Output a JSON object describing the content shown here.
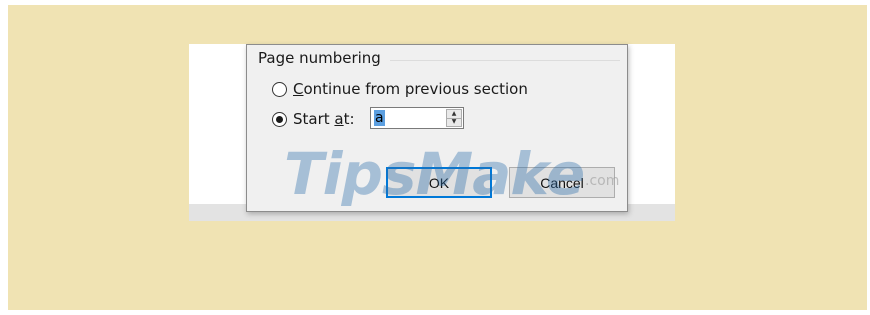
{
  "dialog": {
    "group_title": "Page numbering",
    "continue_option": {
      "label_mnemonic": "C",
      "label_rest": "ontinue from previous section",
      "checked": false
    },
    "start_option": {
      "label_before": "Start ",
      "label_mnemonic": "a",
      "label_after": "t:",
      "checked": true
    },
    "start_value": "a",
    "ok_label": "OK",
    "cancel_label": "Cancel"
  },
  "watermark": {
    "text": "TipsMake",
    "suffix": ".com"
  },
  "colors": {
    "background": "#f0e3b3",
    "dialog": "#f0f0f0",
    "focus_accent": "#0078d7",
    "selection": "#5c9fe0"
  }
}
